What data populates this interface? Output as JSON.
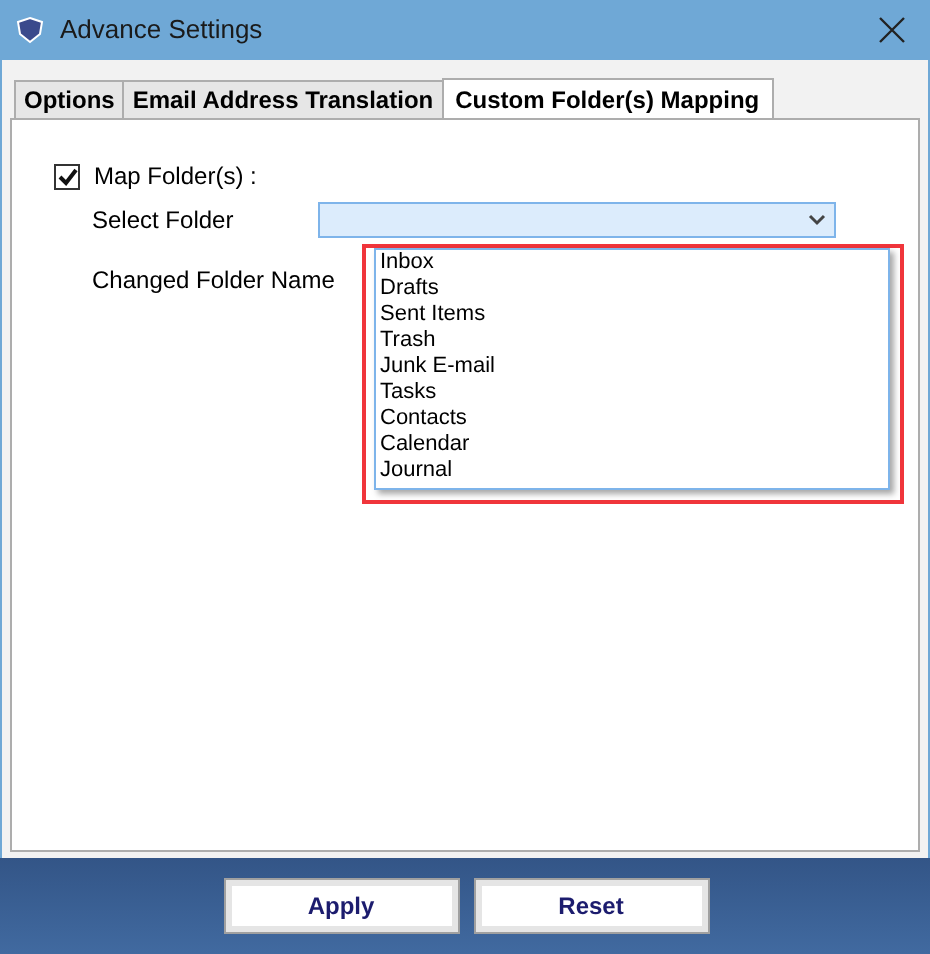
{
  "window": {
    "title": "Advance Settings"
  },
  "tabs": [
    {
      "label": "Options",
      "selected": false
    },
    {
      "label": "Email Address Translation",
      "selected": false
    },
    {
      "label": "Custom Folder(s) Mapping",
      "selected": true
    }
  ],
  "map_folders": {
    "label": "Map Folder(s) :",
    "checked": true
  },
  "select_folder": {
    "label": "Select Folder",
    "expanded": true,
    "options": [
      {
        "label": "Inbox"
      },
      {
        "label": "Drafts"
      },
      {
        "label": "Sent Items"
      },
      {
        "label": "Trash"
      },
      {
        "label": "Junk E-mail"
      },
      {
        "label": "Tasks"
      },
      {
        "label": "Contacts"
      },
      {
        "label": "Calendar"
      },
      {
        "label": "Journal"
      }
    ]
  },
  "changed_folder_name": {
    "label": "Changed Folder Name"
  },
  "buttons": [
    {
      "label": "Apply"
    },
    {
      "label": "Reset"
    }
  ]
}
